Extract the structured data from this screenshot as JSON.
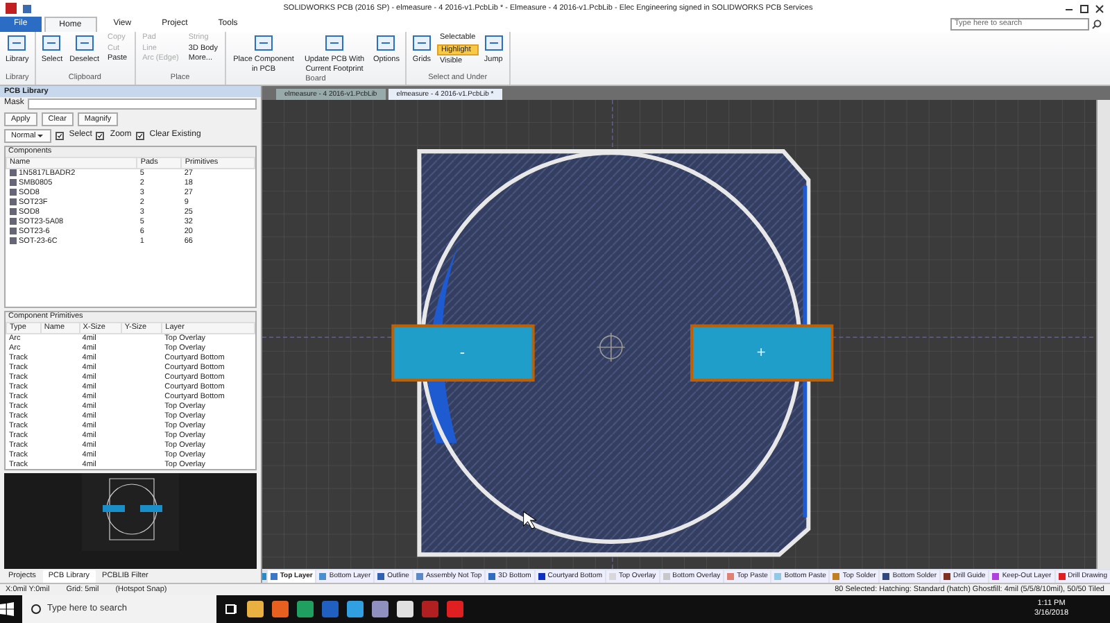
{
  "title_bar": {
    "title": "SOLIDWORKS PCB (2016 SP) - elmeasure - 4 2016-v1.PcbLib * - Elmeasure - 4 2016-v1.PcbLib - Elec Engineering signed in SOLIDWORKS PCB Services"
  },
  "ribbon_tabs": [
    {
      "label": "File",
      "kind": "file",
      "selected": false
    },
    {
      "label": "Home",
      "kind": "tab",
      "selected": true
    },
    {
      "label": "View",
      "kind": "tab",
      "selected": false
    },
    {
      "label": "Project",
      "kind": "tab",
      "selected": false
    },
    {
      "label": "Tools",
      "kind": "tab",
      "selected": false
    }
  ],
  "search": {
    "placeholder": "Type here to search"
  },
  "ribbon_groups": [
    {
      "label": "Library",
      "items": [
        {
          "kind": "large",
          "label": "Library",
          "disabled": false,
          "active": false
        }
      ]
    },
    {
      "label": "Clipboard",
      "items": [
        {
          "kind": "large",
          "label": "Select",
          "disabled": false,
          "active": false
        },
        {
          "kind": "large",
          "label": "Deselect",
          "disabled": false,
          "active": false
        },
        {
          "kind": "small",
          "label": "Copy",
          "disabled": true,
          "active": false
        },
        {
          "kind": "small",
          "label": "Cut",
          "disabled": true,
          "active": false
        },
        {
          "kind": "small",
          "label": "Paste",
          "disabled": false,
          "active": false
        }
      ]
    },
    {
      "label": "Place",
      "items": [
        {
          "kind": "small",
          "label": "Pad",
          "disabled": true,
          "active": false
        },
        {
          "kind": "small",
          "label": "Line",
          "disabled": true,
          "active": false
        },
        {
          "kind": "small",
          "label": "Arc (Edge)",
          "disabled": true,
          "active": false
        },
        {
          "kind": "small",
          "label": "String",
          "disabled": true,
          "active": false
        },
        {
          "kind": "small",
          "label": "3D Body",
          "disabled": false,
          "active": false
        },
        {
          "kind": "small",
          "label": "More...",
          "disabled": false,
          "active": false
        }
      ]
    },
    {
      "label": "Board",
      "items": [
        {
          "kind": "large",
          "label": "Place Component in PCB",
          "disabled": false,
          "active": false
        },
        {
          "kind": "large",
          "label": "Update PCB With Current Footprint",
          "disabled": false,
          "active": false
        },
        {
          "kind": "large",
          "label": "Options",
          "disabled": false,
          "active": false
        }
      ]
    },
    {
      "label": "Select and Under",
      "items": [
        {
          "kind": "large",
          "label": "Grids",
          "disabled": false,
          "active": false
        },
        {
          "kind": "small",
          "label": "Selectable",
          "disabled": false,
          "active": false
        },
        {
          "kind": "small",
          "label": "Highlight",
          "disabled": false,
          "active": true
        },
        {
          "kind": "small",
          "label": "Visible",
          "disabled": false,
          "active": false
        },
        {
          "kind": "large",
          "label": "Jump",
          "disabled": false,
          "active": false
        }
      ]
    }
  ],
  "panel": {
    "title": "PCB Library",
    "mask_label": "Mask",
    "buttons": [
      "Apply",
      "Clear",
      "Magnify"
    ],
    "mode": "Normal",
    "options": [
      {
        "label": "Select",
        "checked": true
      },
      {
        "label": "Zoom",
        "checked": true
      },
      {
        "label": "Clear Existing",
        "checked": true
      }
    ],
    "components": {
      "title": "Components",
      "columns": [
        "Name",
        "Pads",
        "Primitives"
      ],
      "rows": [
        [
          "1N5817LBADR2",
          "5",
          "27"
        ],
        [
          "SMB0805",
          "2",
          "18"
        ],
        [
          "SOD8",
          "3",
          "27"
        ],
        [
          "SOT23F",
          "2",
          "9"
        ],
        [
          "SOD8",
          "3",
          "25"
        ],
        [
          "SOT23-5A08",
          "5",
          "32"
        ],
        [
          "SOT23-6",
          "6",
          "20"
        ],
        [
          "SOT-23-6C",
          "1",
          "66"
        ]
      ]
    },
    "primitives": {
      "title": "Component Primitives",
      "columns": [
        "Type",
        "Name",
        "X-Size",
        "Y-Size",
        "Layer"
      ],
      "rows": [
        [
          "Arc",
          "",
          "4mil",
          "",
          "Top Overlay"
        ],
        [
          "Arc",
          "",
          "4mil",
          "",
          "Top Overlay"
        ],
        [
          "Track",
          "",
          "4mil",
          "",
          "Courtyard Bottom"
        ],
        [
          "Track",
          "",
          "4mil",
          "",
          "Courtyard Bottom"
        ],
        [
          "Track",
          "",
          "4mil",
          "",
          "Courtyard Bottom"
        ],
        [
          "Track",
          "",
          "4mil",
          "",
          "Courtyard Bottom"
        ],
        [
          "Track",
          "",
          "4mil",
          "",
          "Courtyard Bottom"
        ],
        [
          "Track",
          "",
          "4mil",
          "",
          "Top Overlay"
        ],
        [
          "Track",
          "",
          "4mil",
          "",
          "Top Overlay"
        ],
        [
          "Track",
          "",
          "4mil",
          "",
          "Top Overlay"
        ],
        [
          "Track",
          "",
          "4mil",
          "",
          "Top Overlay"
        ],
        [
          "Track",
          "",
          "4mil",
          "",
          "Top Overlay"
        ],
        [
          "Track",
          "",
          "4mil",
          "",
          "Top Overlay"
        ],
        [
          "Track",
          "",
          "4mil",
          "",
          "Top Overlay"
        ]
      ]
    },
    "tabs": [
      {
        "label": "Projects",
        "selected": false
      },
      {
        "label": "PCB Library",
        "selected": true
      },
      {
        "label": "PCBLIB Filter",
        "selected": false
      }
    ]
  },
  "document_tabs": [
    {
      "label": "elmeasure - 4 2016-v1.PcbLib",
      "selected": false
    },
    {
      "label": "elmeasure - 4 2016-v1.PcbLib *",
      "selected": true
    }
  ],
  "canvas": {
    "pads": [
      {
        "label": "-"
      },
      {
        "label": "+"
      }
    ]
  },
  "layer_tabs": [
    {
      "label": "Top Layer",
      "color": "#3b78c8",
      "selected": true
    },
    {
      "label": "Bottom Layer",
      "color": "#4a90d0",
      "selected": false
    },
    {
      "label": "Outline",
      "color": "#3060b0",
      "selected": false
    },
    {
      "label": "Assembly Not Top",
      "color": "#5a88c8",
      "selected": false
    },
    {
      "label": "3D Bottom",
      "color": "#2f6cc0",
      "selected": false
    },
    {
      "label": "Courtyard Bottom",
      "color": "#1030c0",
      "selected": false
    },
    {
      "label": "Top Overlay",
      "color": "#d8d8d8",
      "selected": false
    },
    {
      "label": "Bottom Overlay",
      "color": "#c8c8c8",
      "selected": false
    },
    {
      "label": "Top Paste",
      "color": "#e08070",
      "selected": false
    },
    {
      "label": "Bottom Paste",
      "color": "#90c8e8",
      "selected": false
    },
    {
      "label": "Top Solder",
      "color": "#c08020",
      "selected": false
    },
    {
      "label": "Bottom Solder",
      "color": "#304880",
      "selected": false
    },
    {
      "label": "Drill Guide",
      "color": "#803020",
      "selected": false
    },
    {
      "label": "Keep-Out Layer",
      "color": "#b040e0",
      "selected": false
    },
    {
      "label": "Drill Drawing",
      "color": "#e02020",
      "selected": false
    }
  ],
  "status_bar": {
    "left": [
      "X:0mil Y:0mil",
      "Grid: 5mil",
      "(Hotspot Snap)"
    ],
    "right": "80 Selected: Hatching: Standard (hatch) Ghostfill: 4mil (5/5/8/10mil), 50/50 Tiled"
  },
  "taskbar": {
    "search_placeholder": "Type here to search",
    "time": "1:11 PM",
    "date": "3/16/2018"
  }
}
